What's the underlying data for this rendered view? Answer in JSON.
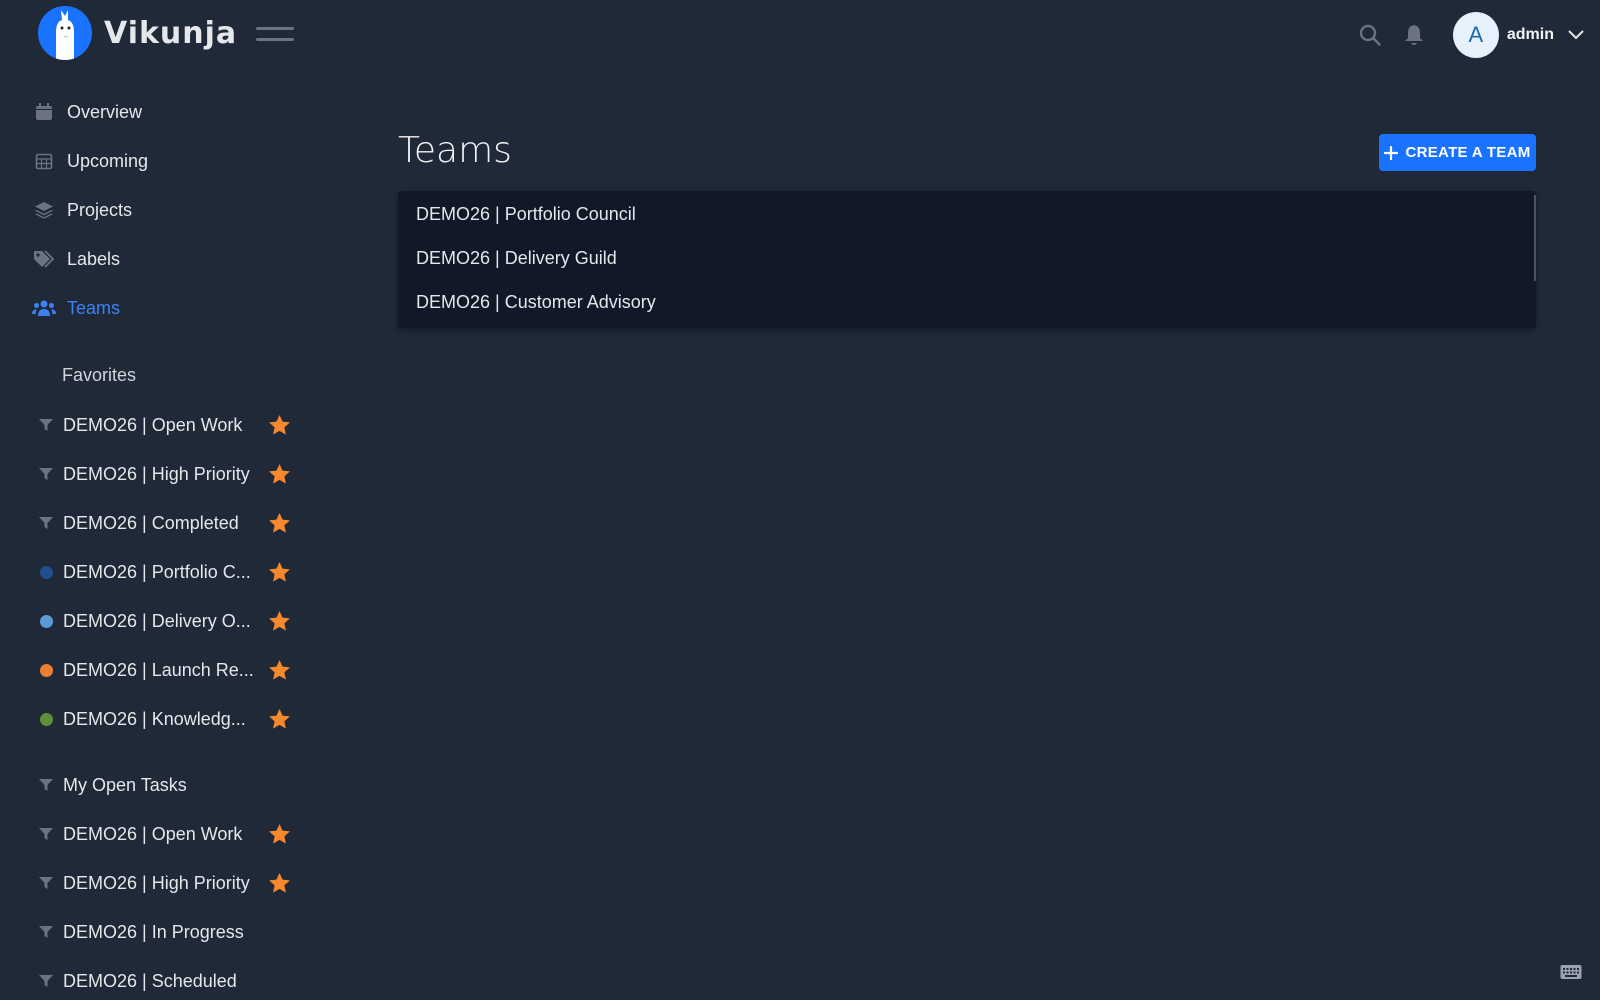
{
  "app": {
    "name": "Vikunja"
  },
  "user": {
    "initial": "A",
    "name": "admin"
  },
  "nav": [
    {
      "label": "Overview",
      "icon": "calendar-icon"
    },
    {
      "label": "Upcoming",
      "icon": "calendar-grid-icon"
    },
    {
      "label": "Projects",
      "icon": "layers-icon"
    },
    {
      "label": "Labels",
      "icon": "tags-icon"
    },
    {
      "label": "Teams",
      "icon": "users-icon",
      "active": true
    }
  ],
  "favorites": {
    "title": "Favorites",
    "items": [
      {
        "label": "DEMO26 | Open Work",
        "type": "filter",
        "starred": true
      },
      {
        "label": "DEMO26 | High Priority",
        "type": "filter",
        "starred": true
      },
      {
        "label": "DEMO26 | Completed",
        "type": "filter",
        "starred": true
      },
      {
        "label": "DEMO26 | Portfolio C...",
        "type": "project",
        "color": "#1e4e8c",
        "starred": true
      },
      {
        "label": "DEMO26 | Delivery O...",
        "type": "project",
        "color": "#5b9bd5",
        "starred": true
      },
      {
        "label": "DEMO26 | Launch Re...",
        "type": "project",
        "color": "#ed7d31",
        "starred": true
      },
      {
        "label": "DEMO26 | Knowledg...",
        "type": "project",
        "color": "#5f8f3a",
        "starred": true
      }
    ]
  },
  "filters": {
    "title": "My Open Tasks",
    "items": [
      {
        "label": "DEMO26 | Open Work",
        "starred": true
      },
      {
        "label": "DEMO26 | High Priority",
        "starred": true
      },
      {
        "label": "DEMO26 | In Progress",
        "starred": false
      },
      {
        "label": "DEMO26 | Scheduled",
        "starred": false
      }
    ]
  },
  "page": {
    "title": "Teams",
    "create_label": "CREATE A TEAM",
    "teams": [
      "DEMO26 | Portfolio Council",
      "DEMO26 | Delivery Guild",
      "DEMO26 | Customer Advisory"
    ]
  },
  "colors": {
    "accent": "#1973ff",
    "star": "#f6882e",
    "background": "#1f2937",
    "card": "#111827"
  }
}
